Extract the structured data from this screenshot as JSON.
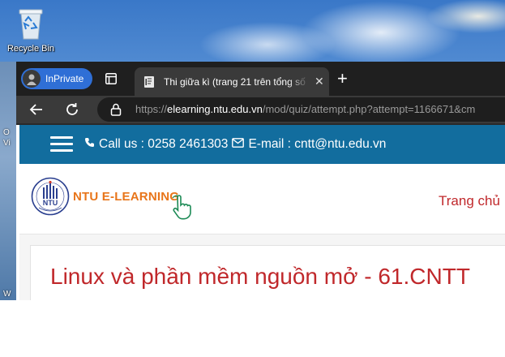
{
  "desktop": {
    "recycle_bin_label": "Recycle Bin",
    "side_icon_labels": [
      "O",
      "Vi",
      "W"
    ]
  },
  "browser": {
    "profile_label": "InPrivate",
    "tab": {
      "title": "Thi giữa kì (trang 21 trên tổng số",
      "icon": "document-icon"
    },
    "address": {
      "scheme": "https://",
      "host": "elearning.ntu.edu.vn",
      "path": "/mod/quiz/attempt.php?attempt=1166671&cm"
    }
  },
  "page": {
    "contact": {
      "phone": "Call us : 0258 2461303",
      "email": "E-mail : cntt@ntu.edu.vn"
    },
    "logo": {
      "brand": "NTU E-LEARNING",
      "emblem_text": "NTU"
    },
    "nav_link": "Trang chủ",
    "course_title": "Linux và phần mềm nguồn mở - 61.CNTT"
  },
  "colors": {
    "contact_bar": "#126d9e",
    "brand_orange": "#e8751a",
    "title_red": "#c0282b",
    "inprivate_blue": "#2f6fd6"
  }
}
